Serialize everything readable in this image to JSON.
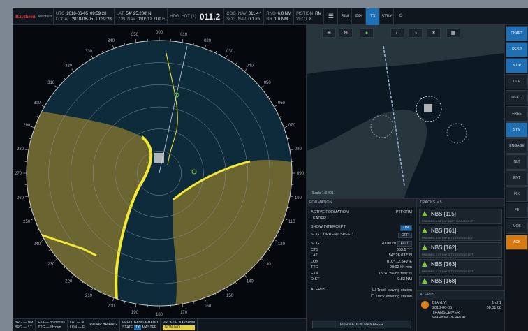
{
  "topbar": {
    "brand": "Raytheon",
    "brand_sub": "Anschütz",
    "utc_label": "UTC",
    "utc_date": "2018-06-05",
    "utc_time": "09:59:28",
    "local_label": "LOCAL",
    "local_date": "2018-06-05",
    "local_time": "10:39:28",
    "lat_label": "LAT",
    "lat_value": "54° 25.208' N",
    "lon_label": "LON",
    "lon_source": "NAV",
    "lon_value": "010° 12.710' E",
    "hdg_label": "HDG",
    "hdg_source": "HDT (1)",
    "hdg_value": "011.2",
    "cog_label": "COG",
    "cog_source": "NAV",
    "cog_value": "011.4 °",
    "sog_label": "SOG",
    "sog_source": "NAV",
    "sog_value": "0.1 kn",
    "rng_label": "RNG",
    "rng_value": "6.0 NM",
    "br_label": "BR",
    "br_value": "1.0 NM",
    "motion_label": "MOTION",
    "motion_value": "RM",
    "vect_label": "VECT",
    "vect_value": "8",
    "buttons": [
      "SIM",
      "PPI",
      "TX",
      "STBY"
    ],
    "active_button": "TX"
  },
  "right_col": {
    "items": [
      "CHART",
      "RESP",
      "N UP",
      "CUP",
      "OFF C",
      "FREE",
      "SYM",
      "ENGAGE",
      "NLT",
      "ENT",
      "FIX",
      "FE",
      "MOB",
      "ACK"
    ]
  },
  "chart_toolbar": [
    "⊕",
    "⊖",
    "●",
    "◐",
    "◑",
    "✶",
    "▦"
  ],
  "chart_scale": "Scale 1:8 401",
  "formation": {
    "title": "FORMATION",
    "active_label": "ACTIVE FORMATION",
    "active_value": "PTFORM",
    "leader_label": "LEADER",
    "intercept_label": "SHOW INTERCEPT",
    "intercept_value": "ON",
    "sog_current_label": "SOG CURRENT SPEED",
    "sog_current_value": "OFF",
    "sog_label": "SOG",
    "sog_value": "20.00",
    "sog_unit": "kn",
    "edit_label": "EDIT",
    "cts_label": "CTS",
    "cts_value": "353.1",
    "cts_unit": "° T",
    "lat_label": "LAT",
    "lat_value": "54° 26.032'",
    "lat_unit": "N",
    "lon_label": "LON",
    "lon_value": "010° 12.549'",
    "lon_unit": "E",
    "ttg_label": "TTG",
    "ttg_value": "00:02",
    "ttg_unit": "hh:mm",
    "eta_label": "ETA",
    "eta_value": "09:41:56",
    "eta_unit": "hh:mm:ss",
    "dist_label": "DIST",
    "dist_value": "0.83",
    "dist_unit": "NM",
    "alerts_label": "ALERTS",
    "track_leaving": "Track leaving station",
    "track_entering": "Track entering station",
    "manager_button": "FORMATION MANAGER"
  },
  "tracks": {
    "header": "TRACKS = 5",
    "items": [
      {
        "name": "NBS [115]",
        "info": "RNG/BRG 4.38 Nm* 262°T COG/SOG 0°T"
      },
      {
        "name": "NBS [161]",
        "info": "RNG/BRG 1.99 Nm* 8°T COG/SOG 323°T"
      },
      {
        "name": "NBS [162]",
        "info": "RNG/BRG 3.97 Nm* 3°T COG/SOG 15°T"
      },
      {
        "name": "NBS [163]",
        "info": "RNG/BRG 4.37 Nm* 3°T COG/SOG 10°T"
      },
      {
        "name": "NBS [168]",
        "info": ""
      }
    ]
  },
  "alerts": {
    "header": "ALERTS",
    "source": "BIANLYI",
    "count": "1 of 1",
    "date": "2018-06-05",
    "time": "08:01:08",
    "line1": "TRANSCEIVER",
    "line2": "WARNING/ERROR"
  },
  "bottombar": {
    "brg_label": "BRG",
    "brg_value": "NM",
    "brg2_label": "BRG",
    "brg2_value": "° T",
    "eta_label": "ETA",
    "eta_value": "hh:mm:ss",
    "ttg_label": "TTG",
    "ttg_value": "hh:mm",
    "lat_label": "LAT",
    "lat_unit": "N",
    "lon_label": "LON",
    "lon_unit": "E",
    "radar_label": "RADAR",
    "radar_value": "BRIAN02",
    "freq_label": "FREQ. BAND",
    "freq_value": "X-BAND",
    "state_label": "STATE",
    "state_value": "TX",
    "master_label": "MASTER",
    "profile_label": "PROFILE",
    "profile_value": "NAV24NM",
    "non_imo": "NON IMO"
  },
  "radar": {
    "bearings": [
      "000",
      "010",
      "020",
      "030",
      "040",
      "050",
      "060",
      "070",
      "080",
      "090",
      "100",
      "110",
      "120",
      "130",
      "140",
      "150",
      "160",
      "170",
      "180",
      "190",
      "200",
      "210",
      "220",
      "230",
      "240",
      "250",
      "260",
      "270",
      "280",
      "290",
      "300",
      "310",
      "320",
      "330",
      "340",
      "350"
    ],
    "colors": {
      "land": "#6b6531",
      "sea": "#0d2b3a",
      "coast": "#f2e935",
      "ring": "#c9c9c9"
    }
  }
}
